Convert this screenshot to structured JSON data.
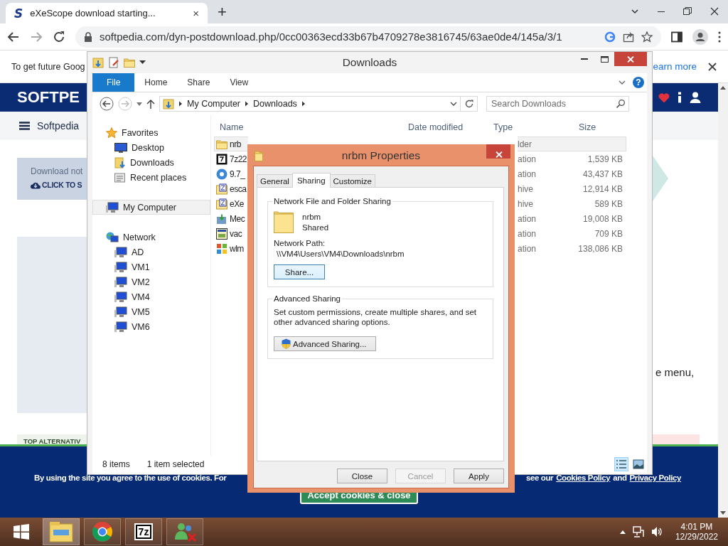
{
  "browser": {
    "tab": {
      "favicon": "S",
      "title": "eXeScope download starting...",
      "close": "×"
    },
    "new_tab": "+",
    "url": "softpedia.com/dyn-postdownload.php/0cc00363ecd33b67b4709278e3816745/63ae0de4/145a/3/1"
  },
  "page": {
    "infobar": {
      "text": "To get future Goog",
      "link": "earn more"
    },
    "logo": "SOFTPE",
    "breadcrumb": "Softpedia",
    "download_notice": "Download not",
    "download_link": "CLICK TO S",
    "side_text": "e menu,",
    "section_heading": "TOP ALTERNATIV",
    "cookie_banner": {
      "text": "By using the site you agree to the use of cookies. For",
      "text_2": "see our",
      "links": [
        "Cookies Policy",
        "Privacy Policy"
      ],
      "joiner": "and",
      "button": "Accept cookies & close"
    }
  },
  "explorer": {
    "title": "Downloads",
    "ribbon_tabs": [
      {
        "label": "File",
        "kind": "file"
      },
      {
        "label": "Home",
        "kind": "tab"
      },
      {
        "label": "Share",
        "kind": "tab"
      },
      {
        "label": "View",
        "kind": "tab"
      }
    ],
    "help": "?",
    "path": [
      "My Computer",
      "Downloads"
    ],
    "search": {
      "placeholder": "Search Downloads"
    },
    "nav": [
      {
        "label": "Favorites",
        "kind": "star",
        "selected": false,
        "children": [
          {
            "label": "Desktop",
            "kind": "desktop",
            "selected": false
          },
          {
            "label": "Downloads",
            "kind": "downloads",
            "selected": false
          },
          {
            "label": "Recent places",
            "kind": "recent",
            "selected": false
          }
        ]
      },
      {
        "label": "My Computer",
        "kind": "computer",
        "selected": true
      },
      {
        "label": "Network",
        "kind": "network",
        "selected": false,
        "children": [
          {
            "label": "AD",
            "kind": "computer",
            "selected": false
          },
          {
            "label": "VM1",
            "kind": "computer",
            "selected": false
          },
          {
            "label": "VM2",
            "kind": "computer",
            "selected": false
          },
          {
            "label": "VM4",
            "kind": "computer",
            "selected": false
          },
          {
            "label": "VM5",
            "kind": "computer",
            "selected": false
          },
          {
            "label": "VM6",
            "kind": "computer",
            "selected": false
          }
        ]
      }
    ],
    "columns": [
      "Name",
      "Date modified",
      "Type",
      "Size"
    ],
    "rows": [
      {
        "name": "nrb",
        "kind": "folder",
        "type": "lder",
        "selected": true
      },
      {
        "name": "7z22",
        "kind": "archive",
        "type": "ation",
        "size": "1,539 KB",
        "selected": false
      },
      {
        "name": "9.7_",
        "kind": "app",
        "type": "ation",
        "size": "43,437 KB",
        "selected": false
      },
      {
        "name": "esca",
        "kind": "zip",
        "type": "hive",
        "size": "12,914 KB",
        "selected": false
      },
      {
        "name": "eXe",
        "kind": "zip",
        "type": "hive",
        "size": "589 KB",
        "selected": false
      },
      {
        "name": "Mec",
        "kind": "installer",
        "type": "ation",
        "size": "19,008 KB",
        "selected": false
      },
      {
        "name": "vac",
        "kind": "setup",
        "type": "ation",
        "size": "709 KB",
        "selected": false
      },
      {
        "name": "wlm",
        "kind": "flag",
        "type": "ation",
        "size": "138,086 KB",
        "selected": false
      }
    ],
    "status": {
      "count": "8 items",
      "selection": "1 item selected"
    },
    "views": [
      {
        "kind": "details",
        "selected": true
      },
      {
        "kind": "icons",
        "selected": false
      }
    ]
  },
  "dialog": {
    "title": "nrbm Properties",
    "tabs": [
      {
        "label": "General",
        "selected": false
      },
      {
        "label": "Sharing",
        "selected": true
      },
      {
        "label": "Customize",
        "selected": false
      }
    ],
    "sharing_group": {
      "title": "Network File and Folder Sharing",
      "folder_name": "nrbm",
      "folder_status": "Shared",
      "path_label": "Network Path:",
      "path": "\\\\VM4\\Users\\VM4\\Downloads\\nrbm",
      "button": {
        "label": "Share...",
        "focused": true
      }
    },
    "advanced_group": {
      "title": "Advanced Sharing",
      "description": "Set custom permissions, create multiple shares, and set other advanced sharing options.",
      "button": "Advanced Sharing..."
    },
    "buttons": [
      {
        "label": "Close",
        "disabled": false
      },
      {
        "label": "Cancel",
        "disabled": true
      },
      {
        "label": "Apply",
        "disabled": false
      }
    ]
  },
  "taskbar": {
    "apps": [
      {
        "kind": "explorer",
        "selected": true
      },
      {
        "kind": "chrome",
        "selected": false
      },
      {
        "kind": "archiver",
        "label": "7z",
        "selected": false
      },
      {
        "kind": "messenger",
        "selected": false
      }
    ],
    "time": "4:01 PM",
    "date": "12/29/2022"
  }
}
